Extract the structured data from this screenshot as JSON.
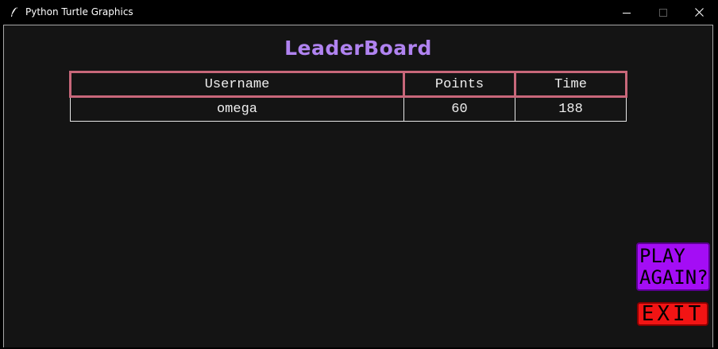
{
  "window": {
    "title": "Python Turtle Graphics",
    "icons": {
      "app": "feather-icon",
      "minimize": "minimize-icon",
      "maximize": "maximize-icon",
      "close": "close-icon"
    }
  },
  "leaderboard": {
    "title": "LeaderBoard",
    "headers": [
      "Username",
      "Points",
      "Time"
    ],
    "rows": [
      [
        "omega",
        "60",
        "188"
      ]
    ]
  },
  "buttons": {
    "play_again_line1": "PLAY",
    "play_again_line2": "AGAIN?",
    "exit": "EXIT"
  },
  "colors": {
    "title": "#b083f0",
    "header_border": "#c8677a",
    "play_again": "#a40df5",
    "exit": "#f21414",
    "canvas": "#141414"
  }
}
